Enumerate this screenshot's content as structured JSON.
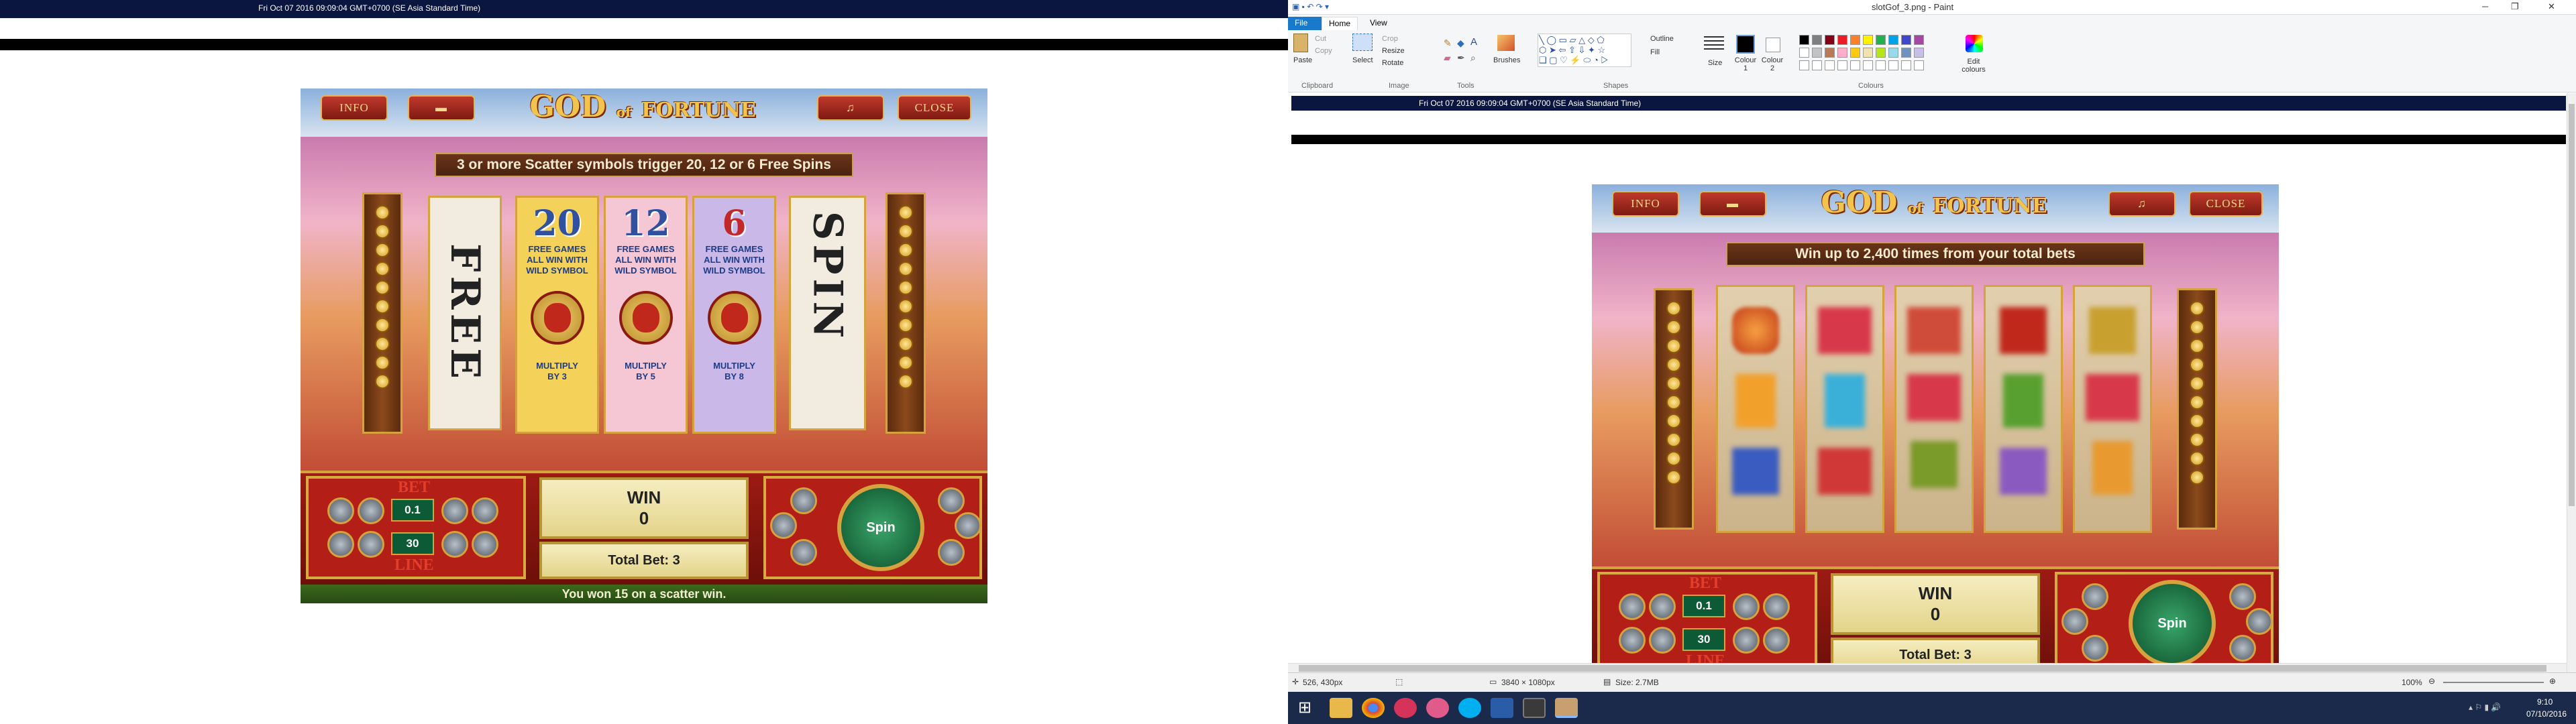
{
  "left": {
    "timestamp": "Fri Oct 07 2016 09:09:04 GMT+0700 (SE Asia Standard Time)",
    "game": {
      "info_label": "INFO",
      "sound_label": "♫",
      "close_label": "CLOSE",
      "logo_top": "GOD",
      "logo_of": "of",
      "logo_bottom": "FORTUNE",
      "banner": "3 or more Scatter symbols trigger 20, 12 or 6 Free Spins",
      "free_cards": [
        {
          "number": "20",
          "line1": "FREE GAMES",
          "line2": "ALL WIN WITH",
          "line3": "WILD SYMBOL",
          "mult1": "MULTIPLY",
          "mult2": "BY 3",
          "color": "#f4d25a"
        },
        {
          "number": "12",
          "line1": "FREE GAMES",
          "line2": "ALL WIN WITH",
          "line3": "WILD SYMBOL",
          "mult1": "MULTIPLY",
          "mult2": "BY 5",
          "color": "#f5c6d3"
        },
        {
          "number": "6",
          "line1": "FREE GAMES",
          "line2": "ALL WIN WITH",
          "line3": "WILD SYMBOL",
          "mult1": "MULTIPLY",
          "mult2": "BY 8",
          "color": "#c9b8e8"
        }
      ],
      "free_word": "FREE",
      "spin_word": "SPIN",
      "bet_label": "BET",
      "line_label": "LINE",
      "bet_value": "0.1",
      "line_value": "30",
      "win_label": "WIN",
      "win_value": "0",
      "total_bet": "Total Bet: 3",
      "spin_label": "Spin",
      "status": "You won 15 on a scatter win."
    }
  },
  "right": {
    "window_title": "slotGof_3.png - Paint",
    "tabs": [
      "File",
      "Home",
      "View"
    ],
    "ribbon": {
      "paste": "Paste",
      "cut": "Cut",
      "copy": "Copy",
      "clipboard": "Clipboard",
      "select": "Select",
      "crop": "Crop",
      "resize": "Resize",
      "rotate": "Rotate",
      "image": "Image",
      "tools": "Tools",
      "brushes": "Brushes",
      "shapes": "Shapes",
      "outline": "Outline",
      "fill": "Fill",
      "size": "Size",
      "colour1": "Colour 1",
      "colour2": "Colour 2",
      "colours": "Colours",
      "edit_colours": "Edit colours"
    },
    "palette": [
      "#000000",
      "#7f7f7f",
      "#880015",
      "#ed1c24",
      "#ff7f27",
      "#fff200",
      "#22b14c",
      "#00a2e8",
      "#3f48cc",
      "#a349a4",
      "#ffffff",
      "#c3c3c3",
      "#b97a57",
      "#ffaec9",
      "#ffc90e",
      "#efe4b0",
      "#b5e61d",
      "#99d9ea",
      "#7092be",
      "#c8bfe7"
    ],
    "timestamp": "Fri Oct 07 2016 09:09:04 GMT+0700 (SE Asia Standard Time)",
    "game": {
      "info_label": "INFO",
      "sound_label": "♫",
      "close_label": "CLOSE",
      "logo_top": "GOD",
      "logo_of": "of",
      "logo_bottom": "FORTUNE",
      "banner": "Win up to 2,400 times from your total bets",
      "bet_label": "BET",
      "line_label": "LINE",
      "bet_value": "0.1",
      "line_value": "30",
      "win_label": "WIN",
      "win_value": "0",
      "total_bet": "Total Bet: 3",
      "spin_label": "Spin"
    },
    "status": {
      "cursor": "526, 430px",
      "dimensions": "3840 × 1080px",
      "size": "Size: 2.7MB",
      "zoom": "100%"
    },
    "clock": {
      "time": "9:10",
      "date": "07/10/2016"
    }
  }
}
